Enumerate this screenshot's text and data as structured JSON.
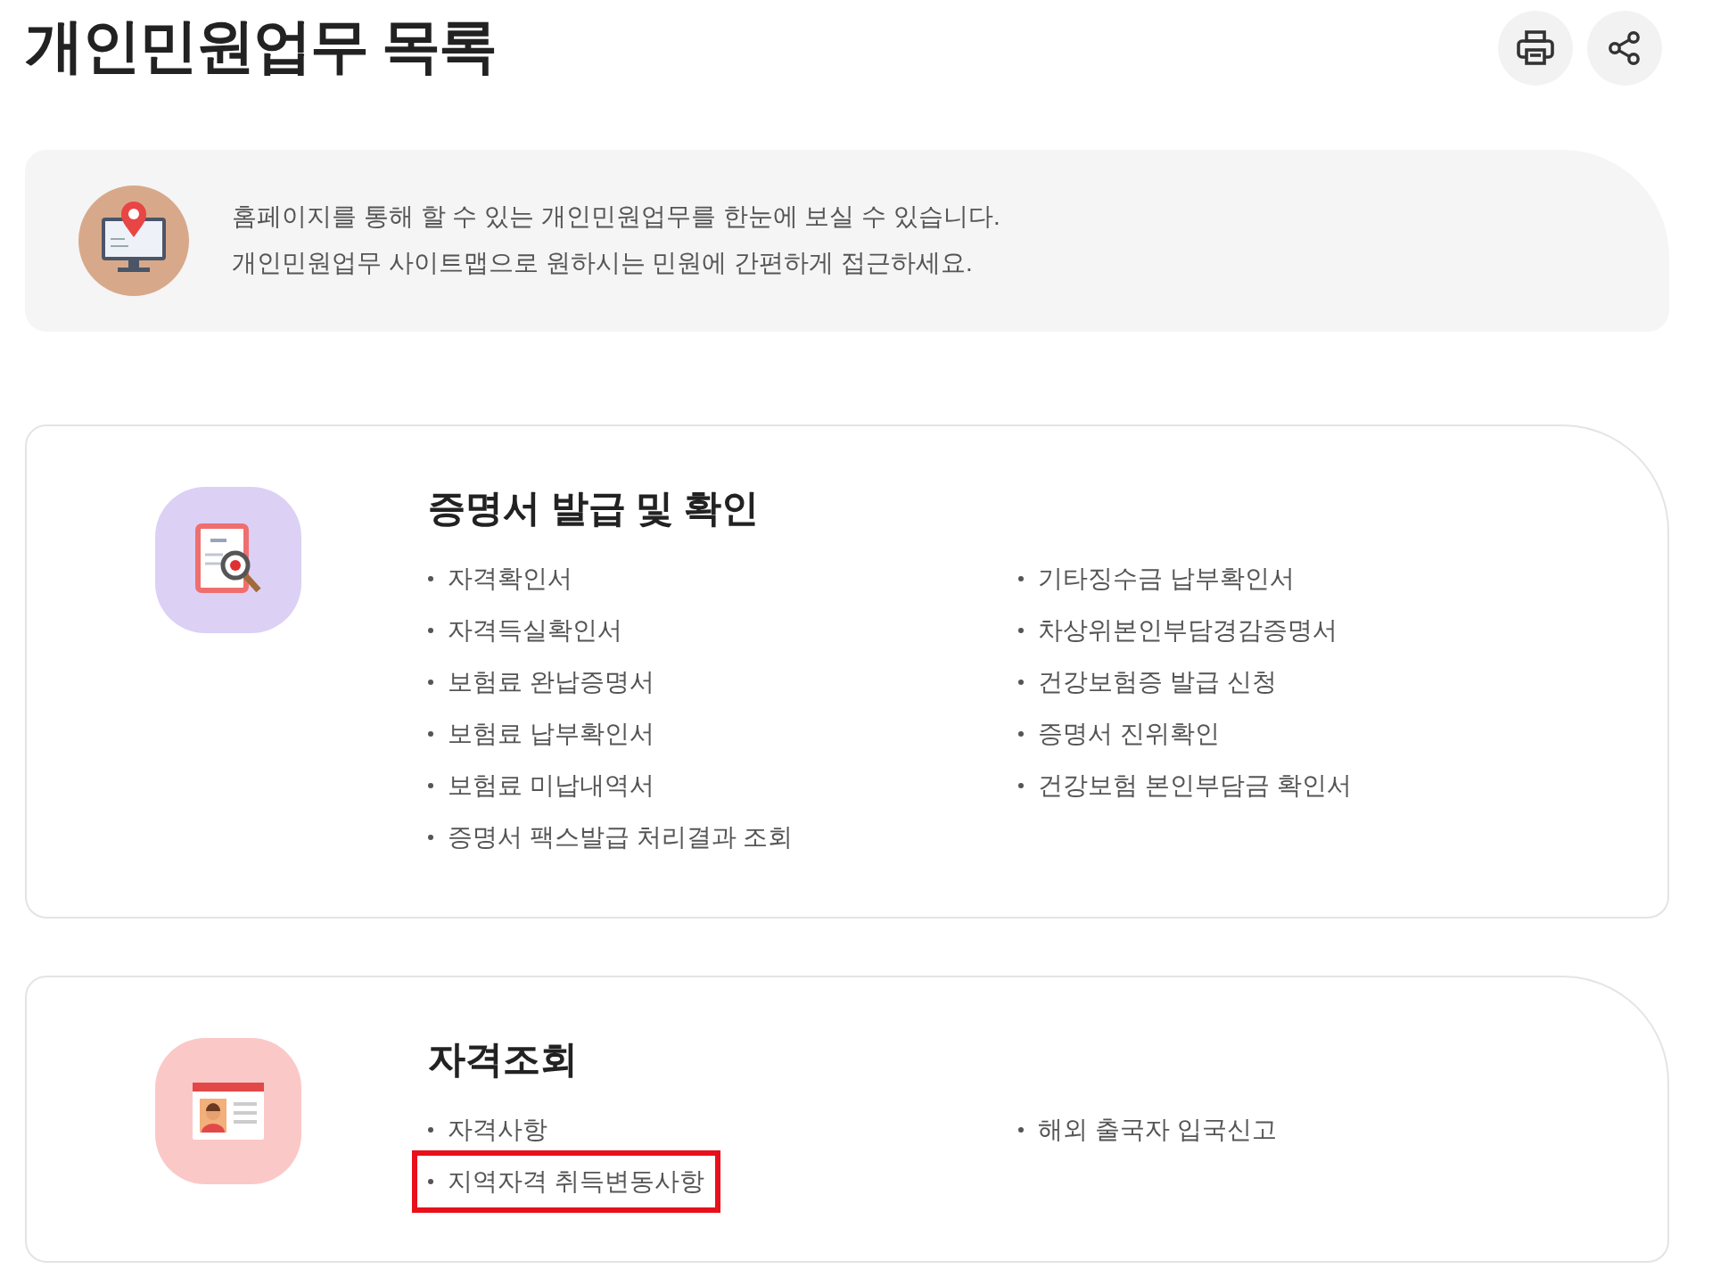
{
  "page_title": "개인민원업무 목록",
  "intro": {
    "lines": [
      "홈페이지를 통해 할 수 있는 개인민원업무를 한눈에 보실 수 있습니다.",
      "개인민원업무 사이트맵으로 원하시는 민원에 간편하게 접근하세요."
    ]
  },
  "sections": [
    {
      "title": "증명서 발급 및 확인",
      "kind": "document",
      "left_items": [
        {
          "label": "자격확인서",
          "highlighted": false
        },
        {
          "label": "자격득실확인서",
          "highlighted": false
        },
        {
          "label": "보험료 완납증명서",
          "highlighted": false
        },
        {
          "label": "보험료 납부확인서",
          "highlighted": false
        },
        {
          "label": "보험료 미납내역서",
          "highlighted": false
        },
        {
          "label": "증명서 팩스발급 처리결과 조회",
          "highlighted": false
        }
      ],
      "right_items": [
        {
          "label": "기타징수금 납부확인서",
          "highlighted": false
        },
        {
          "label": "차상위본인부담경감증명서",
          "highlighted": false
        },
        {
          "label": "건강보험증 발급 신청",
          "highlighted": false
        },
        {
          "label": "증명서 진위확인",
          "highlighted": false
        },
        {
          "label": "건강보험 본인부담금 확인서",
          "highlighted": false
        }
      ]
    },
    {
      "title": "자격조회",
      "kind": "id-card",
      "left_items": [
        {
          "label": "자격사항",
          "highlighted": false
        },
        {
          "label": "지역자격 취득변동사항",
          "highlighted": true
        }
      ],
      "right_items": [
        {
          "label": "해외 출국자 입국신고",
          "highlighted": false
        }
      ]
    }
  ]
}
